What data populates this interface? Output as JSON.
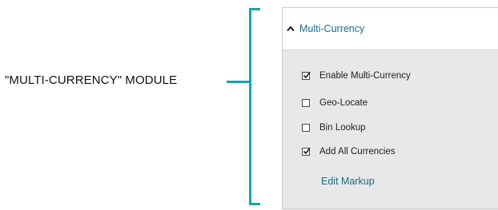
{
  "annotation": {
    "label": "\"MULTI-CURRENCY\" MODULE",
    "accent_color": "#14a6ad"
  },
  "module": {
    "title": "Multi-Currency",
    "expanded_icon": "chevron-up-icon",
    "options": [
      {
        "label": "Enable Multi-Currency",
        "checked": true
      },
      {
        "label": "Geo-Locate",
        "checked": false
      },
      {
        "label": "Bin Lookup",
        "checked": false
      },
      {
        "label": "Add All Currencies",
        "checked": true
      }
    ],
    "edit_link": "Edit Markup",
    "link_color": "#1a6a87",
    "panel_color": "#e8e8e8"
  }
}
